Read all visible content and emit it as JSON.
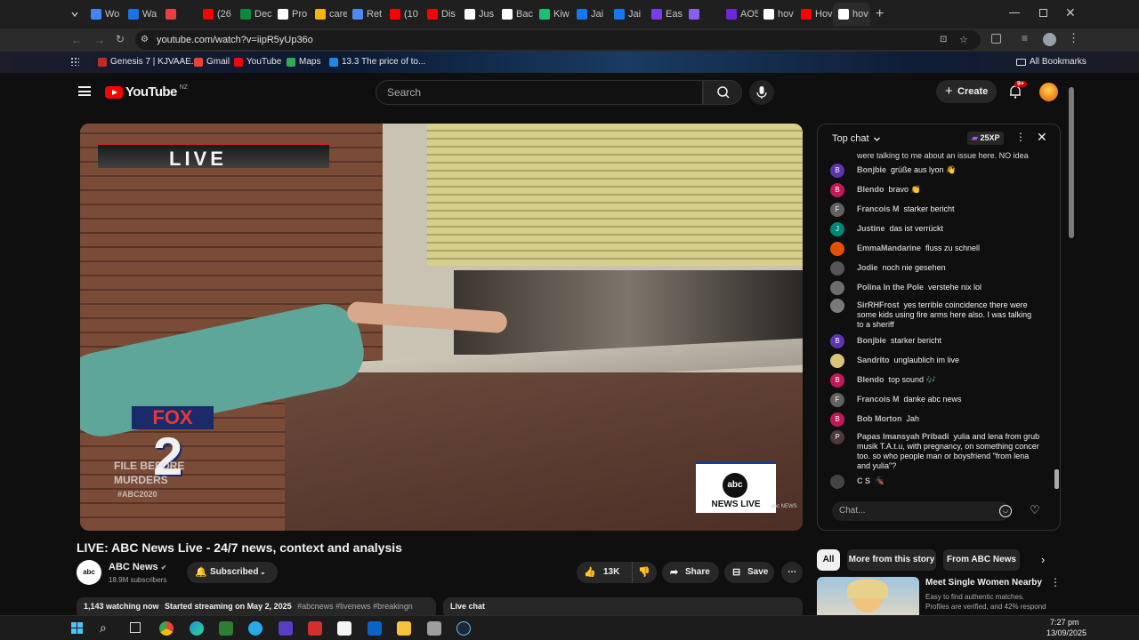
{
  "browser": {
    "tabs": [
      {
        "label": "Wo",
        "color": "#4285f4"
      },
      {
        "label": "Wa",
        "color": "#1a73e8"
      },
      {
        "label": "",
        "color": "#e84040"
      },
      {
        "label": "(26",
        "color": "#ff0000"
      },
      {
        "label": "Dec",
        "color": "#0b8a3e"
      },
      {
        "label": "Pro",
        "color": "#ffffff"
      },
      {
        "label": "care",
        "color": "#f5b50a"
      },
      {
        "label": "Ret",
        "color": "#4c8bf5"
      },
      {
        "label": "(10",
        "color": "#ff0000"
      },
      {
        "label": "Dis",
        "color": "#ff0000"
      },
      {
        "label": "Jus",
        "color": "#ffffff"
      },
      {
        "label": "Bac",
        "color": "#ffffff"
      },
      {
        "label": "Kiw",
        "color": "#1dbf73"
      },
      {
        "label": "Jai",
        "color": "#1877f2"
      },
      {
        "label": "Jai",
        "color": "#1877f2"
      },
      {
        "label": "Eas",
        "color": "#7c3aed"
      },
      {
        "label": "",
        "color": "#8b5cf6"
      },
      {
        "label": "AO5",
        "color": "#6d28d9"
      },
      {
        "label": "hov",
        "color": "#ffffff"
      },
      {
        "label": "Hov",
        "color": "#ff0000"
      },
      {
        "label": "hov",
        "color": "#ffffff"
      }
    ],
    "url": "youtube.com/watch?v=iipR5yUp36o",
    "bookmarks": [
      {
        "label": "Genesis 7 | KJVAAE...",
        "color": "#c62828"
      },
      {
        "label": "Gmail",
        "color": "#ea4335"
      },
      {
        "label": "YouTube",
        "color": "#ff0000"
      },
      {
        "label": "Maps",
        "color": "#34a853"
      },
      {
        "label": "13.3 The price of to...",
        "color": "#1e88e5"
      }
    ],
    "all_bookmarks": "All Bookmarks"
  },
  "yt": {
    "logo_text": "YouTube",
    "region": "NZ",
    "search_placeholder": "Search",
    "create_label": "Create",
    "notif_count": "9+"
  },
  "video": {
    "live_banner": "LIVE",
    "station_fox": "FOX",
    "station_num": "2",
    "file_text_1": "FILE BEFORE",
    "file_text_2": "MURDERS",
    "hashtag": "#ABC2020",
    "abc_logo": "abc",
    "newslive": "NEWS LIVE",
    "watermark": "abc NEWS"
  },
  "chat": {
    "header": "Top chat",
    "xp": "25XP",
    "truncated_top": "were talking to me about an issue here. NO idea",
    "input_placeholder": "Chat...",
    "messages": [
      {
        "initial": "B",
        "color": "#5e35b1",
        "author": "Bonjbie",
        "text": "grüße aus lyon 👋"
      },
      {
        "initial": "B",
        "color": "#c2185b",
        "author": "Blendo",
        "text": "bravo 👏"
      },
      {
        "initial": "F",
        "color": "#616161",
        "author": "Francois M",
        "text": "starker bericht"
      },
      {
        "initial": "J",
        "color": "#00897b",
        "author": "Justine",
        "text": "das ist verrückt"
      },
      {
        "initial": "",
        "color": "#e65100",
        "author": "EmmaMandarine",
        "text": "fluss zu schnell"
      },
      {
        "initial": "",
        "color": "#555555",
        "author": "Jodie",
        "text": "noch nie gesehen"
      },
      {
        "initial": "",
        "color": "#6d6d6d",
        "author": "Polina In the Pole",
        "text": "verstehe nix lol"
      },
      {
        "initial": "",
        "color": "#7a7a7a",
        "author": "SirRHFrost",
        "text": "yes terrible coincidence there were some kids using fire arms here also. I was talking to a sheriff"
      },
      {
        "initial": "B",
        "color": "#5e35b1",
        "author": "Bonjbie",
        "text": "starker bericht"
      },
      {
        "initial": "",
        "color": "#d8c37a",
        "author": "Sandrito",
        "text": "unglaublich im live"
      },
      {
        "initial": "B",
        "color": "#c2185b",
        "author": "Blendo",
        "text": "top sound 🎶"
      },
      {
        "initial": "F",
        "color": "#616161",
        "author": "Francois M",
        "text": "danke abc news"
      },
      {
        "initial": "B",
        "color": "#c2185b",
        "author": "Bob Morton",
        "text": "Jah"
      },
      {
        "initial": "P",
        "color": "#4a3a3a",
        "author": "Papas Imansyah Pribadi",
        "text": "yulia and lena from grub musik T.A.t.u, with pregnancy, on something concer too. so who people man or boysfriend \"from lena and yulia\"?"
      },
      {
        "initial": "",
        "color": "#444444",
        "author": "C S",
        "text": "🪳"
      }
    ]
  },
  "info": {
    "title": "LIVE: ABC News Live - 24/7 news, context and analysis",
    "channel": "ABC News",
    "subscribers": "18.9M subscribers",
    "subscribed_label": "Subscribed",
    "likes": "13K",
    "share_label": "Share",
    "save_label": "Save",
    "watching": "1,143 watching now",
    "started": "Started streaming on May 2, 2025",
    "hashtags": "#abcnews #livenews #breakingn",
    "live_chat_label": "Live chat"
  },
  "related": {
    "filters": [
      "All",
      "More from this story",
      "From ABC News"
    ],
    "ad_title": "Meet Single Women Nearby",
    "ad_line1": "Easy to find authentic matches.",
    "ad_line2": "Profiles are verified, and 42% respond"
  },
  "taskbar": {
    "time": "7:27 pm",
    "date": "13/09/2025"
  },
  "colors": {
    "accent_red": "#ff0000",
    "bg": "#0f0f0f",
    "chip_bg": "#272727"
  }
}
